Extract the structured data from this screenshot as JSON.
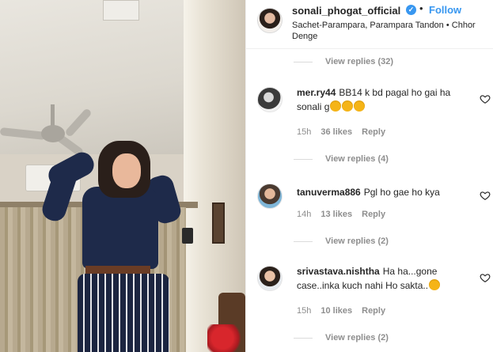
{
  "post": {
    "username": "sonali_phogat_official",
    "follow_label": "Follow",
    "separator": "•",
    "song_line": "Sachet-Parampara, Parampara Tandon • Chhor Denge"
  },
  "top_view_replies": "View replies (32)",
  "comments": [
    {
      "user": "mer.ry44",
      "text": "BB14 k bd pagal ho gai ha sonali g",
      "emoji_count": 3,
      "time": "15h",
      "likes": "36 likes",
      "reply": "Reply",
      "view_replies": "View replies (4)"
    },
    {
      "user": "tanuverma886",
      "text": "Pgl ho gae ho kya",
      "emoji_count": 0,
      "time": "14h",
      "likes": "13 likes",
      "reply": "Reply",
      "view_replies": "View replies (2)"
    },
    {
      "user": "srivastava.nishtha",
      "text": "Ha ha...gone case..inka kuch nahi Ho sakta..",
      "emoji_count": 1,
      "time": "15h",
      "likes": "10 likes",
      "reply": "Reply",
      "view_replies": "View replies (2)"
    }
  ],
  "icons": {
    "verified": "verified-badge-icon",
    "like": "heart-icon",
    "emoji": "laughing-emoji-icon"
  },
  "colors": {
    "accent": "#3897f0",
    "muted": "#8e8e8e",
    "text": "#262626"
  }
}
